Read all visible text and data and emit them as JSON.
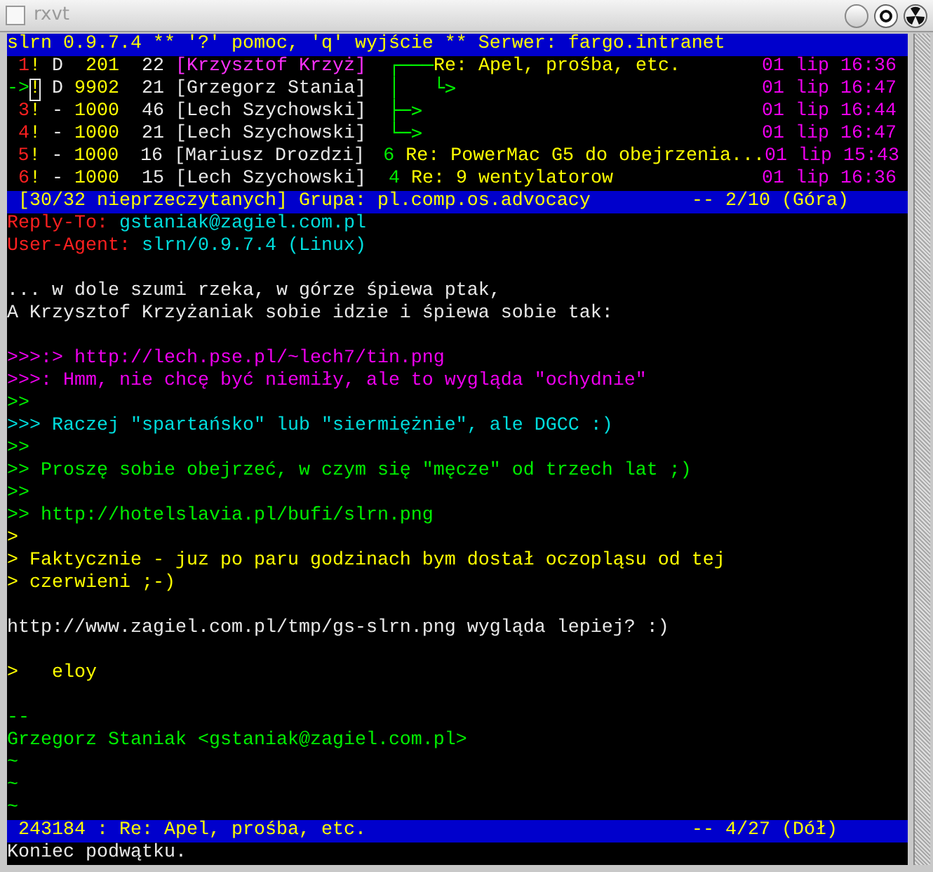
{
  "window": {
    "title": "rxvt"
  },
  "top_bar": {
    "text": "slrn 0.9.7.4 ** '?' pomoc, 'q' wyjście ** Serwer: fargo.intranet"
  },
  "threads": [
    {
      "marker": "1",
      "flag": "!",
      "status": "D",
      "score": "201",
      "lines": "22",
      "author": "[Krzysztof Krzyż]",
      "highlighted": true,
      "tree": "┌───",
      "subject": "Re: Apel, prośba, etc.",
      "date": "01 lip 16:36",
      "selected": false
    },
    {
      "marker": "->",
      "flag": "!",
      "status": "D",
      "score": "9902",
      "lines": "21",
      "author": "[Grzegorz Stania]",
      "highlighted": false,
      "tree": "│   └>",
      "date": "01 lip 16:47",
      "selected": true
    },
    {
      "marker": "3",
      "flag": "!",
      "status": "-",
      "score": "1000",
      "lines": "46",
      "author": "[Lech Szychowski]",
      "highlighted": false,
      "tree": "├─>",
      "date": "01 lip 16:44",
      "selected": false
    },
    {
      "marker": "4",
      "flag": "!",
      "status": "-",
      "score": "1000",
      "lines": "21",
      "author": "[Lech Szychowski]",
      "highlighted": false,
      "tree": "└─>",
      "date": "01 lip 16:47",
      "selected": false
    },
    {
      "marker": "5",
      "flag": "!",
      "status": "-",
      "score": "1000",
      "lines": "16",
      "author": "[Mariusz Drozdzi]",
      "highlighted": false,
      "count": "6",
      "subject": "Re: PowerMac G5 do obejrzenia...",
      "date": "01 lip 15:43",
      "selected": false
    },
    {
      "marker": "6",
      "flag": "!",
      "status": "-",
      "score": "1000",
      "lines": "15",
      "author": "[Lech Szychowski]",
      "highlighted": false,
      "count": "4",
      "subject": "Re: 9 wentylatorow",
      "date": "01 lip 16:36",
      "selected": false
    }
  ],
  "group_bar": {
    "left": "[30/32 nieprzeczytanych] Grupa: pl.comp.os.advocacy",
    "right": "-- 2/10 (Góra)"
  },
  "article": [
    {
      "kind": "header",
      "name": "Reply-To:",
      "value": "gstaniak@zagiel.com.pl"
    },
    {
      "kind": "header",
      "name": "User-Agent:",
      "value": "slrn/0.9.7.4 (Linux)"
    },
    {
      "kind": "blank"
    },
    {
      "kind": "text",
      "text": "... w dole szumi rzeka, w górze śpiewa ptak,"
    },
    {
      "kind": "text",
      "text": "A Krzysztof Krzyżaniak sobie idzie i śpiewa sobie tak:"
    },
    {
      "kind": "blank"
    },
    {
      "kind": "quote4",
      "text": ">>>:> http://lech.pse.pl/~lech7/tin.png"
    },
    {
      "kind": "quote4",
      "text": ">>>: Hmm, nie chcę być niemiły, ale to wygląda \"ochydnie\""
    },
    {
      "kind": "quote2",
      "text": ">>"
    },
    {
      "kind": "quote3",
      "text": ">>> Raczej \"spartańsko\" lub \"siermiężnie\", ale DGCC :)"
    },
    {
      "kind": "quote2",
      "text": ">>"
    },
    {
      "kind": "quote2",
      "text": ">> Proszę sobie obejrzeć, w czym się \"męcze\" od trzech lat ;)"
    },
    {
      "kind": "quote2",
      "text": ">>"
    },
    {
      "kind": "quote2",
      "text": ">> http://hotelslavia.pl/bufi/slrn.png"
    },
    {
      "kind": "quote1",
      "text": ">"
    },
    {
      "kind": "quote1",
      "text": "> Faktycznie - juz po paru godzinach bym dostał oczopląsu od tej"
    },
    {
      "kind": "quote1",
      "text": "> czerwieni ;-)"
    },
    {
      "kind": "blank"
    },
    {
      "kind": "text",
      "text": "http://www.zagiel.com.pl/tmp/gs-slrn.png wygląda lepiej? :)"
    },
    {
      "kind": "blank"
    },
    {
      "kind": "quote1",
      "text": ">   eloy"
    },
    {
      "kind": "blank"
    },
    {
      "kind": "signature",
      "text": "--"
    },
    {
      "kind": "signature",
      "text": "Grzegorz Staniak <gstaniak@zagiel.com.pl>"
    },
    {
      "kind": "tilde",
      "text": "~"
    },
    {
      "kind": "tilde",
      "text": "~"
    },
    {
      "kind": "tilde",
      "text": "~"
    }
  ],
  "article_bar": {
    "left": "243184 : Re: Apel, prośba, etc.",
    "right": "-- 4/27 (Dół)"
  },
  "message": "Koniec podwątku."
}
